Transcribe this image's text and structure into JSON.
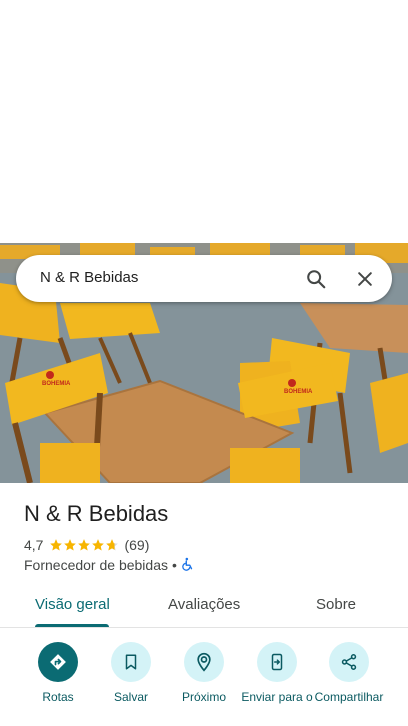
{
  "search": {
    "query": "N & R Bebidas"
  },
  "place": {
    "name": "N & R Bebidas",
    "rating": "4,7",
    "stars": 4.7,
    "reviews_count": "(69)",
    "category": "Fornecedor de bebidas",
    "separator": "•"
  },
  "photo": {
    "umbrella_brand": "BOHEMIA"
  },
  "tabs": [
    {
      "label": "Visão geral",
      "active": true
    },
    {
      "label": "Avaliações",
      "active": false
    },
    {
      "label": "Sobre",
      "active": false
    }
  ],
  "actions": [
    {
      "label": "Rotas",
      "icon": "directions-icon"
    },
    {
      "label": "Salvar",
      "icon": "bookmark-icon"
    },
    {
      "label": "Próximo",
      "icon": "nearby-icon"
    },
    {
      "label": "Enviar para o",
      "icon": "send-to-phone-icon"
    },
    {
      "label": "Compartilhar",
      "icon": "share-icon"
    }
  ],
  "colors": {
    "accent": "#0b6b73",
    "action_bg": "#d4f3f7",
    "star": "#f7b500",
    "chair": "#f2b300",
    "table": "#c48a4f"
  }
}
